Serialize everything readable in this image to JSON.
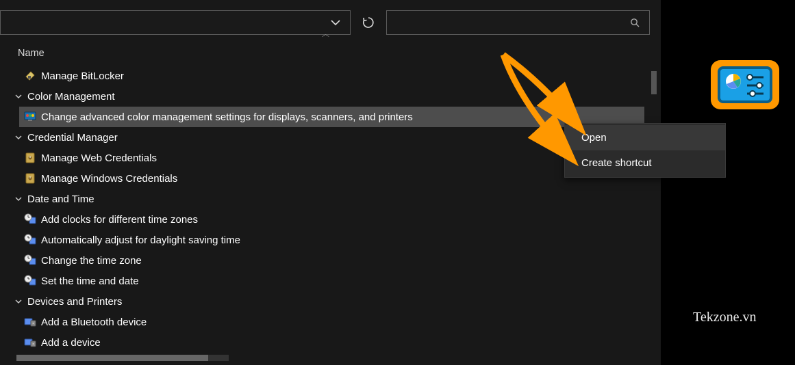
{
  "toolbar": {
    "address_value": "",
    "search_placeholder": ""
  },
  "column_header": "Name",
  "tree": [
    {
      "type": "item-solo",
      "icon": "bitlocker",
      "label": "Manage BitLocker"
    },
    {
      "type": "group",
      "label": "Color Management",
      "items": [
        {
          "icon": "monitor-color",
          "label": "Change advanced color management settings for displays, scanners, and printers",
          "selected": true
        }
      ]
    },
    {
      "type": "group",
      "label": "Credential Manager",
      "items": [
        {
          "icon": "safe",
          "label": "Manage Web Credentials"
        },
        {
          "icon": "safe",
          "label": "Manage Windows Credentials"
        }
      ]
    },
    {
      "type": "group",
      "label": "Date and Time",
      "items": [
        {
          "icon": "clock",
          "label": "Add clocks for different time zones"
        },
        {
          "icon": "clock",
          "label": "Automatically adjust for daylight saving time"
        },
        {
          "icon": "clock",
          "label": "Change the time zone"
        },
        {
          "icon": "clock",
          "label": "Set the time and date"
        }
      ]
    },
    {
      "type": "group",
      "label": "Devices and Printers",
      "items": [
        {
          "icon": "device",
          "label": "Add a Bluetooth device"
        },
        {
          "icon": "device",
          "label": "Add a device"
        }
      ]
    }
  ],
  "context_menu": {
    "items": [
      {
        "label": "Open",
        "highlight": true
      },
      {
        "label": "Create shortcut",
        "highlight": false
      }
    ]
  },
  "watermark": "Tekzone.vn",
  "icons": {
    "chevron-down": "⌄",
    "search": "⌕"
  },
  "colors": {
    "accent_orange": "#ff9800",
    "selected_row": "#4d4d4d"
  }
}
